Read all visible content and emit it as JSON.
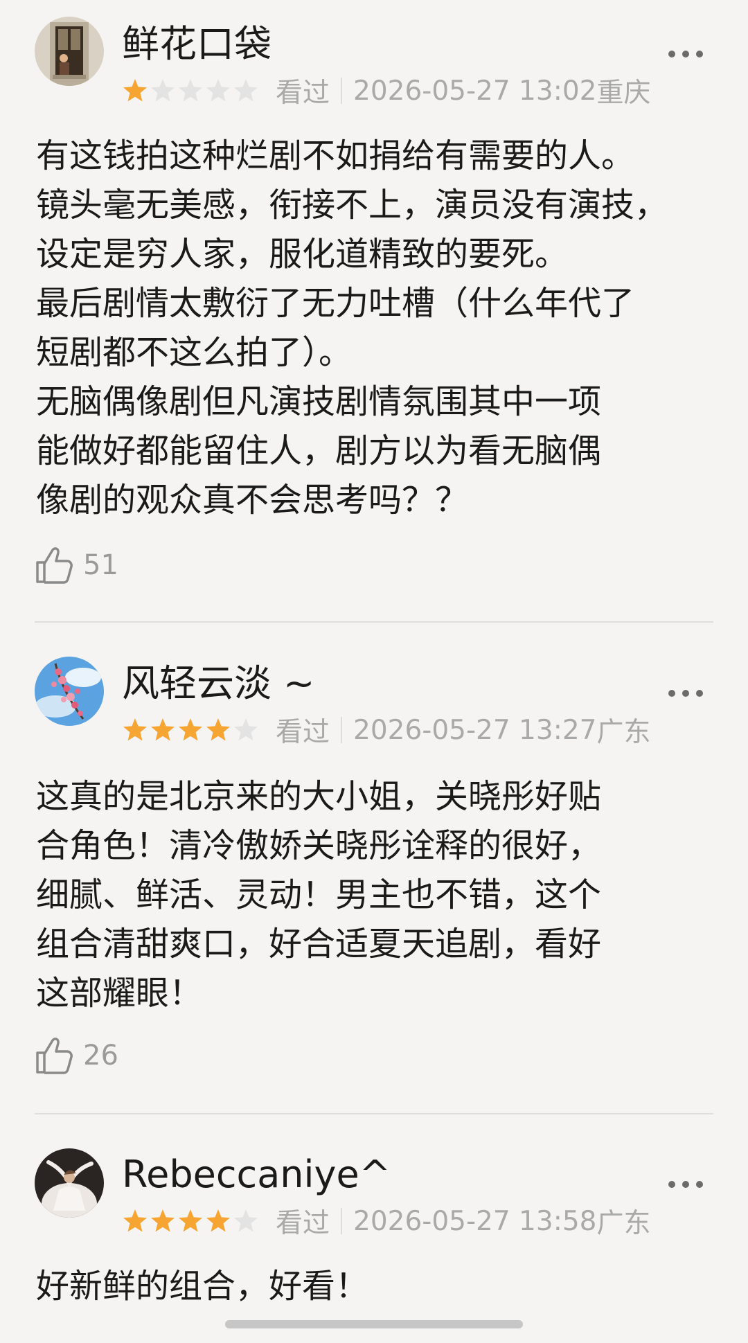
{
  "reviews": [
    {
      "username": "鲜花口袋",
      "rating": 1,
      "max_rating": 5,
      "status": "看过",
      "datetime": "2026-05-27 13:02",
      "location": "重庆",
      "lines": [
        "有这钱拍这种烂剧不如捐给有需要的人。",
        "镜头毫无美感，衔接不上，演员没有演技，",
        "设定是穷人家，服化道精致的要死。",
        "最后剧情太敷衍了无力吐槽（什么年代了",
        "短剧都不这么拍了）。",
        "无脑偶像剧但凡演技剧情氛围其中一项",
        "能做好都能留住人，剧方以为看无脑偶",
        "像剧的观众真不会思考吗？？"
      ],
      "likes": "51",
      "avatar_icon": "window-portrait-avatar"
    },
    {
      "username": "风轻云淡 ~",
      "rating": 4,
      "max_rating": 5,
      "status": "看过",
      "datetime": "2026-05-27 13:27",
      "location": "广东",
      "lines": [
        "这真的是北京来的大小姐，关晓彤好贴",
        "合角色！清冷傲娇关晓彤诠释的很好，",
        "细腻、鲜活、灵动！男主也不错，这个",
        "组合清甜爽口，好合适夏天追剧，看好",
        "这部耀眼！"
      ],
      "likes": "26",
      "avatar_icon": "flowers-sky-avatar"
    },
    {
      "username": "Rebeccaniye^",
      "rating": 4,
      "max_rating": 5,
      "status": "看过",
      "datetime": "2026-05-27 13:58",
      "location": "广东",
      "lines": [
        "好新鲜的组合，好看！"
      ],
      "avatar_icon": "dancer-avatar"
    }
  ],
  "colors": {
    "background": "#f5f4f2",
    "star_filled": "#f7a532",
    "star_empty": "#e3e3e3",
    "meta_text": "#a9a9a9",
    "body_text": "#1a1a1a"
  },
  "icons": {
    "more": "more-dots-icon",
    "like": "thumbs-up-icon",
    "star": "star-icon"
  }
}
